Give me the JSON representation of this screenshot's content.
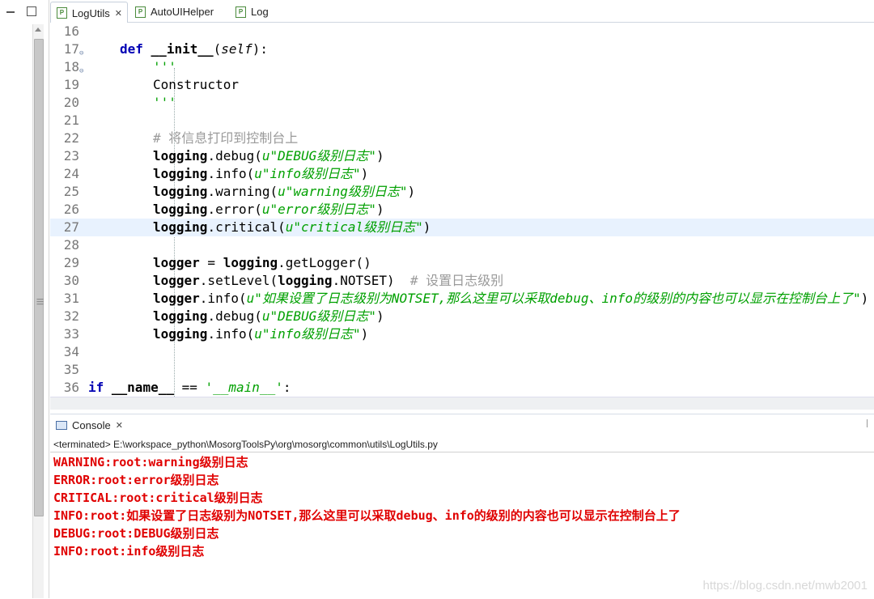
{
  "tabs": [
    {
      "label": "LogUtils",
      "active": true,
      "closable": true,
      "icon": "python-file-icon"
    },
    {
      "label": "AutoUIHelper",
      "active": false,
      "closable": false,
      "icon": "python-file-icon"
    },
    {
      "label": "Log",
      "active": false,
      "closable": false,
      "icon": "python-file-icon"
    }
  ],
  "code_lines": [
    {
      "num": "16",
      "text": ""
    },
    {
      "num": "17",
      "fold": true,
      "text": "def __init__(self):"
    },
    {
      "num": "18",
      "fold": true,
      "text": "'''"
    },
    {
      "num": "19",
      "text": "Constructor"
    },
    {
      "num": "20",
      "text": "'''"
    },
    {
      "num": "21",
      "text": ""
    },
    {
      "num": "22",
      "text": "# 将信息打印到控制台上"
    },
    {
      "num": "23",
      "text": "logging.debug(u\"DEBUG级别日志\")"
    },
    {
      "num": "24",
      "text": "logging.info(u\"info级别日志\")"
    },
    {
      "num": "25",
      "text": "logging.warning(u\"warning级别日志\")"
    },
    {
      "num": "26",
      "text": "logging.error(u\"error级别日志\")"
    },
    {
      "num": "27",
      "text": "logging.critical(u\"critical级别日志\")",
      "highlight": true
    },
    {
      "num": "28",
      "text": ""
    },
    {
      "num": "29",
      "text": "logger = logging.getLogger()"
    },
    {
      "num": "30",
      "text": "logger.setLevel(logging.NOTSET)  # 设置日志级别"
    },
    {
      "num": "31",
      "text": "logger.info(u\"如果设置了日志级别为NOTSET,那么这里可以采取debug、info的级别的内容也可以显示在控制台上了\")"
    },
    {
      "num": "32",
      "text": "logging.debug(u\"DEBUG级别日志\")"
    },
    {
      "num": "33",
      "text": "logging.info(u\"info级别日志\")"
    },
    {
      "num": "34",
      "text": ""
    },
    {
      "num": "35",
      "text": ""
    },
    {
      "num": "36",
      "text": "if __name__ == '__main__':"
    }
  ],
  "console": {
    "tab_label": "Console",
    "terminated_text": "<terminated> E:\\workspace_python\\MosorgToolsPy\\org\\mosorg\\common\\utils\\LogUtils.py",
    "output": [
      "WARNING:root:warning级别日志",
      "ERROR:root:error级别日志",
      "CRITICAL:root:critical级别日志",
      "INFO:root:如果设置了日志级别为NOTSET,那么这里可以采取debug、info的级别的内容也可以显示在控制台上了",
      "DEBUG:root:DEBUG级别日志",
      "INFO:root:info级别日志"
    ],
    "output_color": "#e00000"
  },
  "watermark": "https://blog.csdn.net/mwb2001",
  "colors": {
    "keyword": "#0000b4",
    "string": "#00a000",
    "comment": "#9a9a9a",
    "highlight_line": "#e8f2fe"
  }
}
